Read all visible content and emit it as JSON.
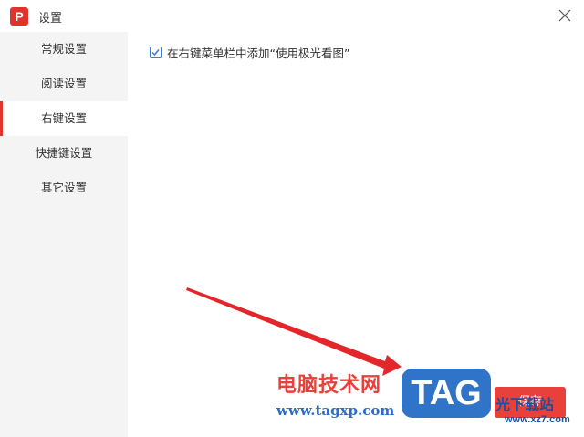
{
  "window": {
    "app_logo_letter": "P",
    "title": "设置",
    "close_icon": "close-icon"
  },
  "sidebar": {
    "items": [
      {
        "label": "常规设置",
        "active": false
      },
      {
        "label": "阅读设置",
        "active": false
      },
      {
        "label": "右键设置",
        "active": true
      },
      {
        "label": "快捷键设置",
        "active": false
      },
      {
        "label": "其它设置",
        "active": false
      }
    ]
  },
  "content": {
    "option": {
      "label": "在右键菜单栏中添加“使用极光看图”",
      "checked": true
    },
    "save_label": "保存"
  },
  "watermark": {
    "cn_text": "电脑技术网",
    "url": "www.tagxp.com",
    "tag_text": "TAG",
    "cn_text2": "光下载站",
    "url2": "www.xz7.com"
  },
  "colors": {
    "brand_red": "#e1332b",
    "checkbox_blue": "#3b7bd6",
    "sidebar_bg": "#f4f4f4"
  }
}
